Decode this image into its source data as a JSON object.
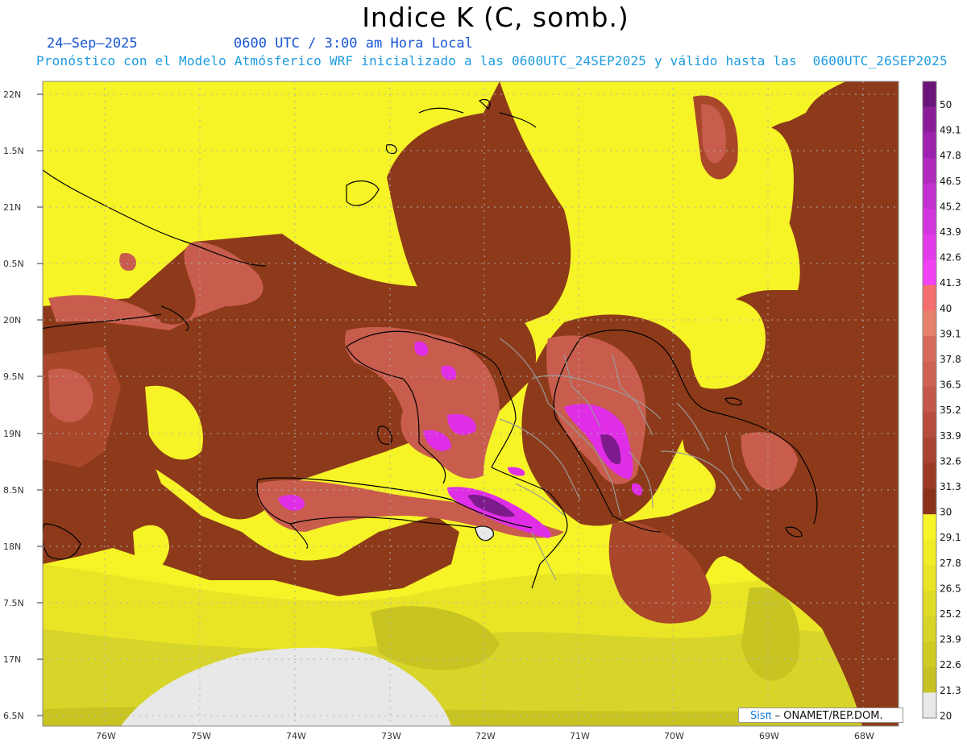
{
  "header": {
    "title": "Indice K (C, somb.)",
    "date": "24–Sep–2025",
    "time": "0600 UTC / 3:00 am Hora Local",
    "forecast": "Pronóstico con el Modelo Atmósferico WRF inicializado a las 0600UTC_24SEP2025 y válido hasta las  0600UTC_26SEP2025"
  },
  "map": {
    "lat_ticks": [
      "22N",
      "1.5N",
      "21N",
      "0.5N",
      "20N",
      "9.5N",
      "19N",
      "8.5N",
      "18N",
      "7.5N",
      "17N",
      "6.5N"
    ],
    "lon_ticks": [
      "76W",
      "75W",
      "74W",
      "73W",
      "72W",
      "71W",
      "70W",
      "69W",
      "68W"
    ],
    "colors": {
      "yellow": "#f6f426",
      "olive": "#d8d52a",
      "olive_dark": "#c8c421",
      "brown": "#8d3a1a",
      "brown_mid": "#a9472a",
      "salmon": "#c85d4d",
      "salmon_light": "#d97062",
      "magenta": "#e02ee6",
      "purple": "#7d1b8c",
      "grey_missing": "#e8e8e8"
    }
  },
  "colorbar": {
    "labels": [
      "50",
      "49.1",
      "47.8",
      "46.5",
      "45.2",
      "43.9",
      "42.6",
      "41.3",
      "40",
      "39.1",
      "37.8",
      "36.5",
      "35.2",
      "33.9",
      "32.6",
      "31.3",
      "30",
      "29.1",
      "27.8",
      "26.5",
      "25.2",
      "23.9",
      "22.6",
      "21.3",
      "20"
    ],
    "colors": [
      "#6b1479",
      "#8a1c9a",
      "#9d22ad",
      "#b02abe",
      "#c230cf",
      "#d235de",
      "#e23be9",
      "#f041f5",
      "#f56e6e",
      "#e7816c",
      "#d86a5b",
      "#cf6152",
      "#c3574a",
      "#b54c3c",
      "#a94230",
      "#9a3a24",
      "#8a3219",
      "#f6f426",
      "#f0ec26",
      "#e9e526",
      "#e0dc26",
      "#d8d425",
      "#cfcb24",
      "#c6c222",
      "#e8e8e8"
    ]
  },
  "credit": {
    "brand": "Sisπ",
    "text": "– ONAMET/REP.DOM."
  }
}
